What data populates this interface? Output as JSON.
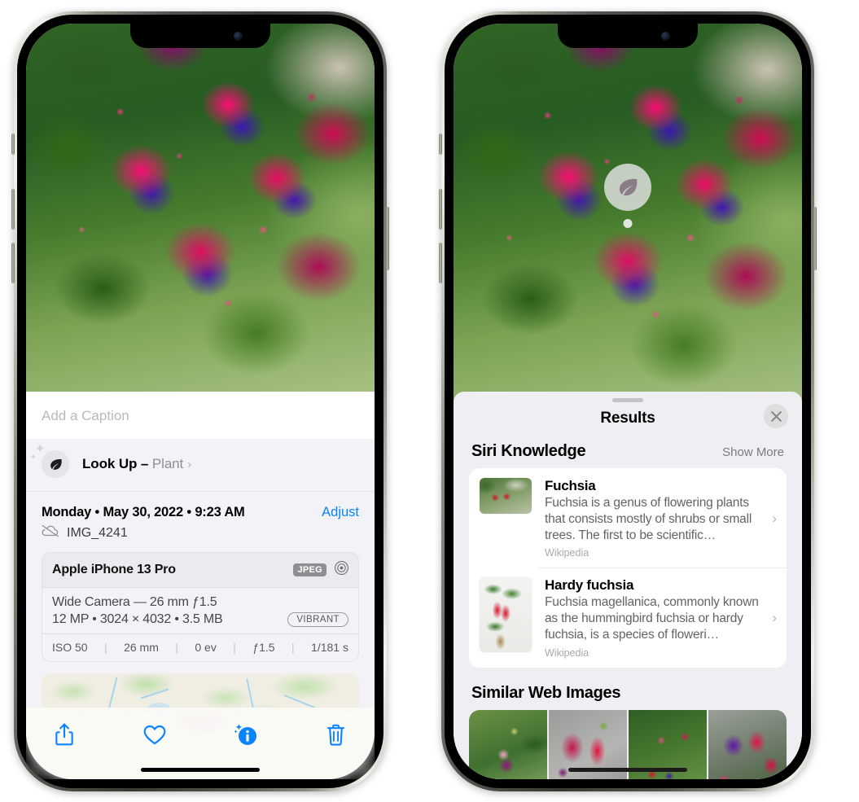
{
  "left_phone": {
    "caption": {
      "placeholder": "Add a Caption",
      "value": ""
    },
    "lookup": {
      "icon": "leaf-icon",
      "label": "Look Up",
      "dash": " – ",
      "subject": "Plant",
      "chevron": "›"
    },
    "date_row": {
      "date": "Monday • May 30, 2022 • 9:23 AM",
      "adjust_label": "Adjust"
    },
    "file_row": {
      "icon": "cloud-slash-icon",
      "filename": "IMG_4241"
    },
    "meta_card": {
      "device": "Apple iPhone 13 Pro",
      "format_badge": "JPEG",
      "aperture_icon": "aperture-icon",
      "lens_line": "Wide Camera — 26 mm ƒ",
      "lens_aperture": "1.5",
      "specs_line": "12 MP • 3024 × 4032 • 3.5 MB",
      "style_badge": "VIBRANT",
      "exif": [
        "ISO 50",
        "26 mm",
        "0 ev",
        "ƒ1.5",
        "1/181 s"
      ]
    },
    "map": {
      "name": "photo-location-map",
      "pin": "photo-pin"
    },
    "toolbar": [
      {
        "name": "share-button",
        "icon": "share-icon"
      },
      {
        "name": "favorite-button",
        "icon": "heart-icon"
      },
      {
        "name": "info-button",
        "icon": "info-sparkle-icon"
      },
      {
        "name": "delete-button",
        "icon": "trash-icon"
      }
    ],
    "accent_color": "#0A84FF"
  },
  "right_phone": {
    "bubble": {
      "icon": "leaf-icon",
      "name": "visual-lookup-bubble"
    },
    "sheet": {
      "grabber": "sheet-grabber",
      "title": "Results",
      "close_icon": "close-icon"
    },
    "siri_knowledge": {
      "heading": "Siri Knowledge",
      "show_more": "Show More",
      "cards": [
        {
          "title": "Fuchsia",
          "description": "Fuchsia is a genus of flowering plants that consists mostly of shrubs or small trees. The first to be scientific…",
          "source": "Wikipedia",
          "chevron": "›"
        },
        {
          "title": "Hardy fuchsia",
          "description": "Fuchsia magellanica, commonly known as the hummingbird fuchsia or hardy fuchsia, is a species of floweri…",
          "source": "Wikipedia",
          "chevron": "›"
        }
      ]
    },
    "similar_web_images": {
      "heading": "Similar Web Images",
      "thumbnails": [
        "fuchsia-pink-white-bloom",
        "fuchsia-red-closeup",
        "fuchsia-bush-buds",
        "fuchsia-purple-red-cluster"
      ]
    }
  }
}
